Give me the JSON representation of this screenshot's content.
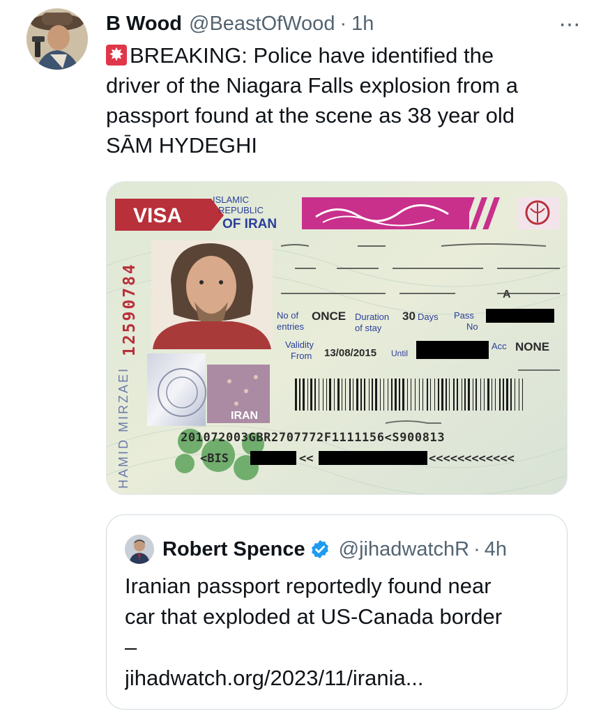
{
  "tweet": {
    "author_name": "B Wood",
    "author_handle": "@BeastOfWood",
    "separator": "·",
    "time": "1h",
    "more_icon": "···",
    "alert_icon": "police-car-light-icon",
    "text": "BREAKING:  Police have identified the\ndriver of the Niagara Falls explosion from a\npassport found at the scene as 38 year old\nSĀM HYDEGHI"
  },
  "visa_card": {
    "visa_label": "VISA",
    "republic_lines": [
      "ISLAMIC",
      "REPUBLIC",
      "OF IRAN"
    ],
    "vertical_number": "12590784",
    "vertical_name": "HAMID MIRZAEI",
    "no_of_entries_label": "No of\nentries",
    "entries_value": "ONCE",
    "duration_label": "Duration\nof stay",
    "duration_value": "30",
    "duration_unit": "Days",
    "pass_no_label": "Pass\nNo",
    "validity_label": "Validity\nFrom",
    "validity_from": "13/08/2015",
    "until_label": "Until",
    "acc_label": "Acc",
    "acc_value": "NONE",
    "hologram_text": "IRAN",
    "mrz_line1": "201072003GBR2707772F1111156<S900813",
    "mrz_line2_prefix": "<BIS",
    "mrz_line2_mid": "<<",
    "mrz_line2_end": "<<<<<<<<<<<<",
    "colors": {
      "red": "#b8303a",
      "magenta": "#c8308c",
      "blue": "#2a3f9a",
      "green": "#4a9a4a"
    }
  },
  "quote": {
    "author_name": "Robert Spence",
    "author_handle": "@jihadwatchR",
    "separator": "·",
    "time": "4h",
    "verified_icon": "verified-badge-icon",
    "lines": [
      "Iranian passport reportedly found near",
      "car that exploded at US-Canada border",
      "–",
      "jihadwatch.org/2023/11/irania..."
    ]
  }
}
